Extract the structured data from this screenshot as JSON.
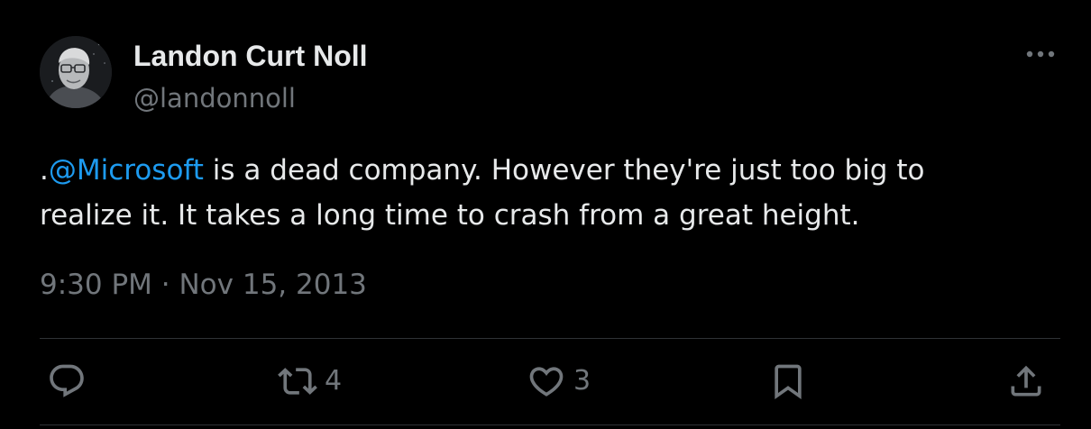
{
  "author": {
    "display_name": "Landon Curt Noll",
    "handle": "@landonnoll"
  },
  "tweet": {
    "prefix": ".",
    "mention": "@Microsoft",
    "line1_rest": " is a dead company. However they're just too big to",
    "line2": "realize it. It takes a long time to crash from a great height."
  },
  "meta": {
    "time": "9:30 PM",
    "separator": " · ",
    "date": "Nov 15, 2013"
  },
  "actions": {
    "reply_count": "",
    "retweet_count": "4",
    "like_count": "3"
  },
  "icons": {
    "more": "more-dots-icon",
    "reply": "reply-bubble-icon",
    "retweet": "retweet-arrows-icon",
    "like": "heart-icon",
    "bookmark": "bookmark-icon",
    "share": "share-upload-icon"
  },
  "colors": {
    "background": "#000000",
    "text": "#e7e9ea",
    "secondary": "#71767b",
    "link": "#1d9bf0",
    "divider": "#2f3336"
  }
}
